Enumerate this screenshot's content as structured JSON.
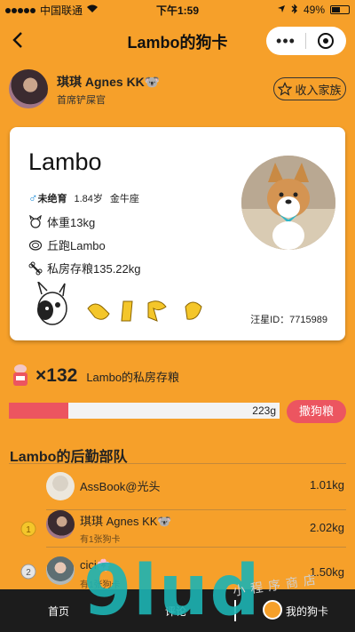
{
  "status_bar": {
    "carrier": "中国联通",
    "time": "下午1:59",
    "battery": "49%",
    "battery_level": 0.49
  },
  "nav": {
    "title": "Lambo的狗卡",
    "more": "•••"
  },
  "owner": {
    "name": "琪琪 Agnes KK🐨",
    "role": "首席铲屎官",
    "family_button": "收入家族"
  },
  "card": {
    "dog_name": "Lambo",
    "gender_symbol": "♂",
    "neuter": "未绝育",
    "age": "1.84岁",
    "sign": "金牛座",
    "weight": "体重13kg",
    "breed": "丘跑Lambo",
    "savings": "私房存粮135.22kg",
    "wangxing_id": "汪星ID：7715989"
  },
  "snack": {
    "count": "×132",
    "label": "Lambo的私房存粮"
  },
  "progress": {
    "text": "223g",
    "fraction": 0.22,
    "button": "撒狗粮"
  },
  "team": {
    "title": "Lambo的后勤部队",
    "rows": [
      {
        "name": "AssBook@光头",
        "sub": "",
        "kg": "1.01kg",
        "rank": ""
      },
      {
        "name": "琪琪 Agnes KK🐨",
        "sub": "有1张狗卡",
        "kg": "2.02kg",
        "rank": "1"
      },
      {
        "name": "cici🌸",
        "sub": "有1张狗卡",
        "kg": "1.50kg",
        "rank": "2"
      }
    ]
  },
  "tabbar": {
    "home": "首页",
    "comment": "评论",
    "mine": "我的狗卡"
  },
  "watermark": {
    "text": "9lud",
    "cn": "小程序商店"
  },
  "colors": {
    "background": "#f6a02a",
    "accent_red": "#ec5560",
    "tabbar": "#1c1c1c"
  }
}
